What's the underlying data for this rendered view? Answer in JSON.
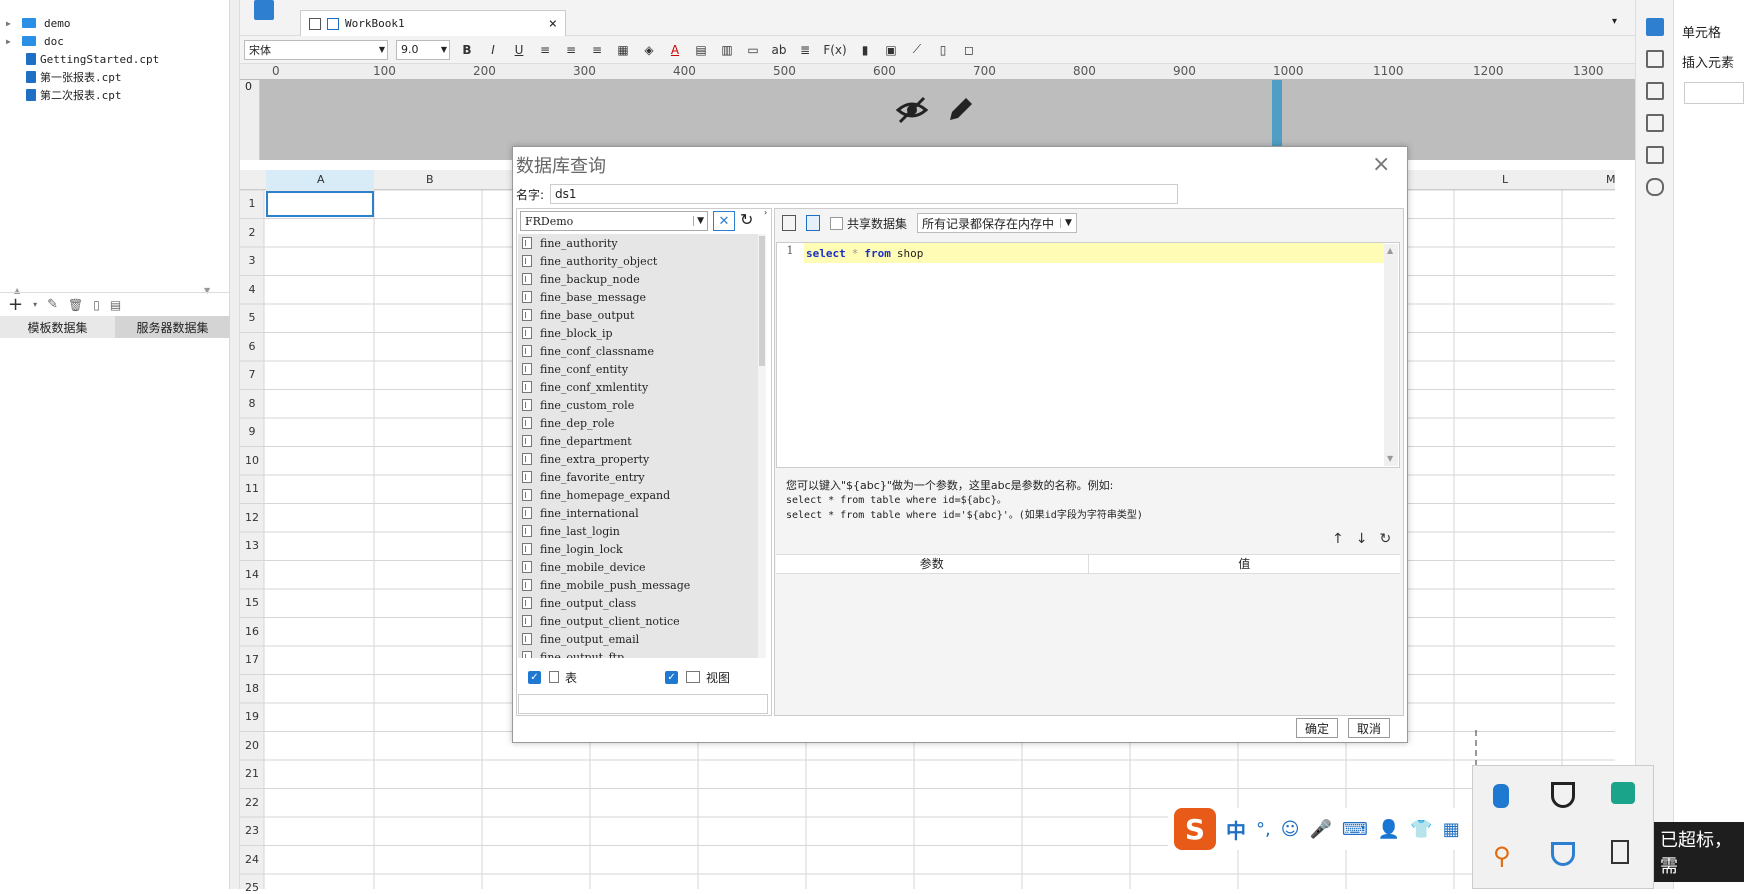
{
  "left_panel": {
    "tree": [
      {
        "label": "demo",
        "type": "folder"
      },
      {
        "label": "doc",
        "type": "folder"
      },
      {
        "label": "GettingStarted.cpt",
        "type": "file"
      },
      {
        "label": "第一张报表.cpt",
        "type": "file"
      },
      {
        "label": "第二次报表.cpt",
        "type": "file"
      }
    ],
    "tabs": [
      "模板数据集",
      "服务器数据集"
    ]
  },
  "doc_tab": {
    "label": "WorkBook1",
    "close": "×"
  },
  "format_bar": {
    "font": "宋体",
    "size": "9.0",
    "bold": "B",
    "italic": "I",
    "underline": "U",
    "ab": "ab",
    "fx": "F(x)"
  },
  "ruler": {
    "ticks": [
      "0",
      "100",
      "200",
      "300",
      "400",
      "500",
      "600",
      "700",
      "800",
      "900",
      "1000",
      "1100",
      "1200",
      "1300"
    ],
    "vtick": "0"
  },
  "grid": {
    "columns": [
      "A",
      "B",
      "L",
      "M"
    ],
    "rows": [
      "1",
      "2",
      "3",
      "4",
      "5",
      "6",
      "7",
      "8",
      "9",
      "10",
      "11",
      "12",
      "13",
      "14",
      "15",
      "16",
      "17",
      "18",
      "19",
      "20",
      "21",
      "22",
      "23",
      "24",
      "25"
    ]
  },
  "right_panel": {
    "items": [
      "单元格",
      "插入元素"
    ]
  },
  "dialog": {
    "title": "数据库查询",
    "close": "×",
    "name_label": "名字:",
    "name_value": "ds1",
    "connection": "FRDemo",
    "tables": [
      "fine_authority",
      "fine_authority_object",
      "fine_backup_node",
      "fine_base_message",
      "fine_base_output",
      "fine_block_ip",
      "fine_conf_classname",
      "fine_conf_entity",
      "fine_conf_xmlentity",
      "fine_custom_role",
      "fine_dep_role",
      "fine_department",
      "fine_extra_property",
      "fine_favorite_entry",
      "fine_homepage_expand",
      "fine_international",
      "fine_last_login",
      "fine_login_lock",
      "fine_mobile_device",
      "fine_mobile_push_message",
      "fine_output_class",
      "fine_output_client_notice",
      "fine_output_email",
      "fine_output_ftp"
    ],
    "show_tables_label": "表",
    "show_views_label": "视图",
    "share_dataset_label": "共享数据集",
    "memory_option": "所有记录都保存在内存中",
    "sql": {
      "line": "1",
      "select": "select",
      "star": "*",
      "from": "from",
      "table": "shop"
    },
    "hint": {
      "line1": "您可以键入\"${abc}\"做为一个参数，这里abc是参数的名称。例如:",
      "line2": "select * from table where id=${abc}。",
      "line3": "select * from table where id='${abc}'。(如果id字段为字符串类型)"
    },
    "param_headers": [
      "参数",
      "值"
    ],
    "ok": "确定",
    "cancel": "取消"
  },
  "ime": {
    "logo": "S",
    "mode": "中",
    "punct": "°,"
  },
  "toast": {
    "text": "已超标，需"
  }
}
